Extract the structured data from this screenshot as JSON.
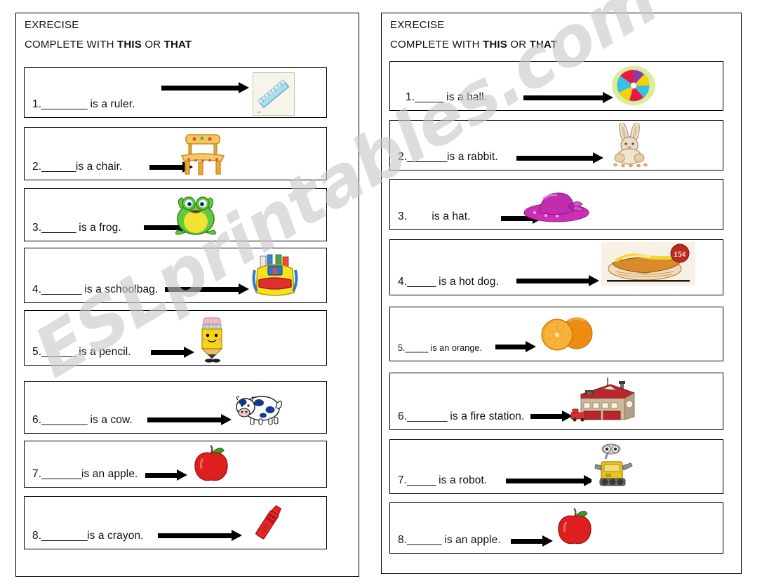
{
  "document": {
    "watermark": "ESLprintables.com",
    "title_bar_absent": true
  },
  "left_panel": {
    "heading": "EXRECISE",
    "instruction_prefix": "COMPLETE WITH ",
    "instruction_bold_1": "THIS",
    "instruction_mid": " OR ",
    "instruction_bold_2": "THAT",
    "items": [
      {
        "num": "1.",
        "blank": "________",
        "text": " is a ruler.",
        "picture": "ruler-image"
      },
      {
        "num": "2.",
        "blank": "______",
        "text": "is a chair.",
        "picture": "chair-image"
      },
      {
        "num": "3.",
        "blank": "______",
        "text": " is a frog.",
        "picture": "frog-image"
      },
      {
        "num": "4.",
        "blank": "_______",
        "text": " is a schoolbag.",
        "picture": "schoolbag-image"
      },
      {
        "num": "5.",
        "blank": "______",
        "text": " is a pencil.",
        "picture": "pencil-image"
      },
      {
        "num": "6.",
        "blank": "________",
        "text": " is a cow.",
        "picture": "cow-image"
      },
      {
        "num": "7.",
        "blank": "_______",
        "text": "is an apple.",
        "picture": "apple-image"
      },
      {
        "num": "8.",
        "blank": "________",
        "text": "is a crayon.",
        "picture": "crayon-image"
      }
    ]
  },
  "right_panel": {
    "heading": "EXRECISE",
    "instruction_prefix": "COMPLETE WITH ",
    "instruction_bold_1": "THIS",
    "instruction_mid": " OR ",
    "instruction_bold_2": "THAT",
    "items": [
      {
        "num": "1.",
        "blank": "_____",
        "text": " is a ball.",
        "picture": "beachball-image"
      },
      {
        "num": "2.",
        "blank": "_______",
        "text": "is a rabbit.",
        "picture": "rabbit-image"
      },
      {
        "num": "3.",
        "blank": "",
        "text": "        is a hat.",
        "picture": "hat-image"
      },
      {
        "num": "4.",
        "blank": "_____",
        "text": " is a hot dog.",
        "picture": "hotdog-image"
      },
      {
        "num": "5.",
        "blank": "_____",
        "text": " is an orange.",
        "picture": "orange-image"
      },
      {
        "num": "6.",
        "blank": "_______",
        "text": " is a fire station.",
        "picture": "firestation-image"
      },
      {
        "num": "7.",
        "blank": "_____",
        "text": " is a robot.",
        "picture": "robot-image"
      },
      {
        "num": "8.",
        "blank": "______",
        "text": " is an apple.",
        "picture": "apple-image"
      }
    ]
  },
  "colors": {
    "ink": "#111111",
    "border": "#000000",
    "watermark_gray": "#c9c9c9",
    "ruler_blue": "#9fd4ea",
    "chair_orange": "#f0a93c",
    "frog_green": "#5cc23f",
    "frog_belly": "#f2e33a",
    "schoolbag_yellow": "#f5de2a",
    "pencil_yellow": "#f7d416",
    "pencil_eraser_pink": "#f6b7c8",
    "cow_blue": "#123a8f",
    "apple_red": "#dd1f1f",
    "apple_leaf_green": "#3b9a2e",
    "crayon_red": "#e52626",
    "ball_red": "#e8193f",
    "ball_yellow": "#f7d100",
    "ball_cyan": "#35c0e8",
    "ball_purple": "#8a3bb0",
    "ball_glow": "#d6e98a",
    "rabbit_tan": "#e8d5b8",
    "hat_magenta": "#cc2fb6",
    "hotdog_badge_red": "#bb2b21",
    "hotdog_badge_text": "15¢",
    "orange_fruit": "#f28c18",
    "firestation_roof": "#b6262b",
    "firestation_wall": "#cdb89a",
    "robot_yellow": "#e8c323"
  }
}
